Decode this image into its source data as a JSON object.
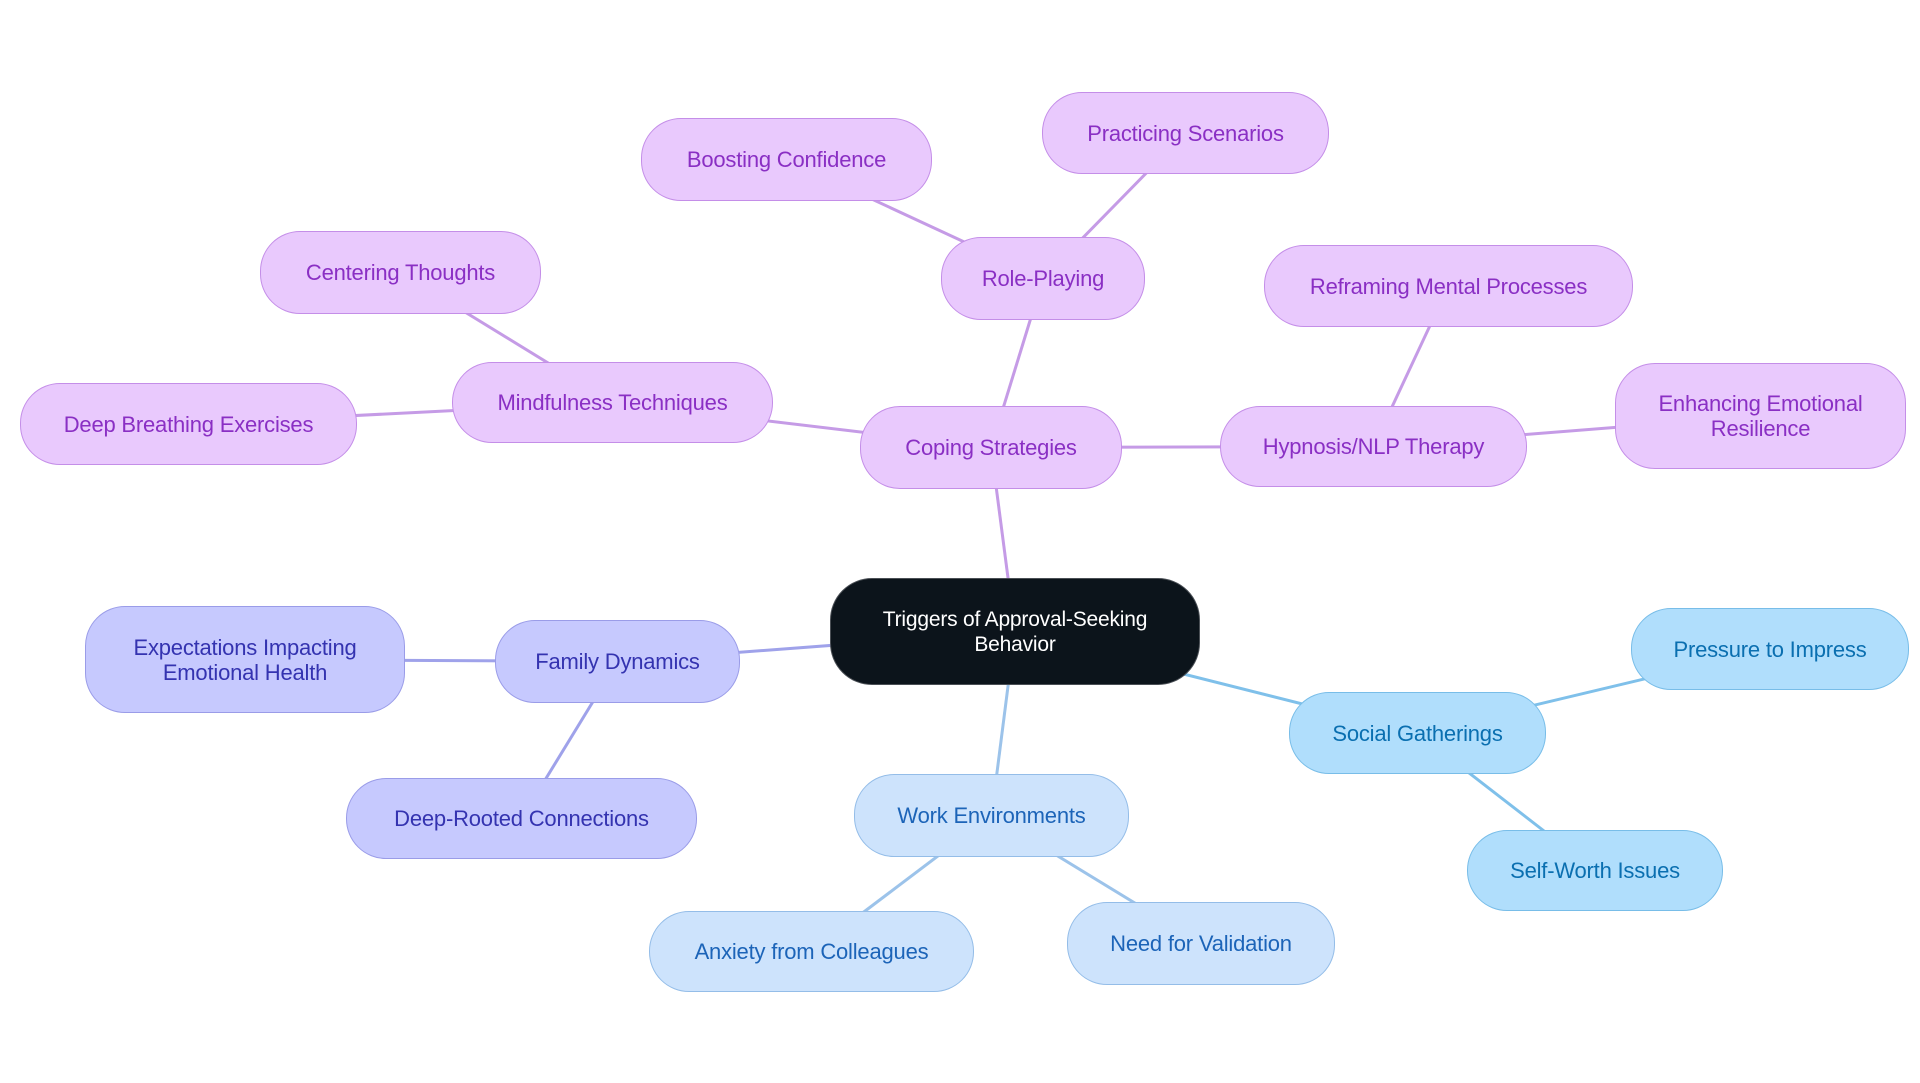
{
  "diagram": {
    "type": "mindmap",
    "colors": {
      "root": "#0c141b",
      "purple": "#e9c9fd",
      "purple_text": "#8a2fc4",
      "purple_edge": "#c59be6",
      "indigo": "#c6c9fe",
      "indigo_text": "#3433b0",
      "indigo_edge": "#9fa2ea",
      "lightblue": "#cde3fc",
      "lightblue_text": "#1c64b8",
      "lightblue_edge": "#9cc3ea",
      "skyblue": "#b0defc",
      "skyblue_text": "#0a6fb0",
      "skyblue_edge": "#7fc0ea"
    },
    "root": {
      "id": "root",
      "label": "Triggers of Approval-Seeking Behavior"
    },
    "nodes": [
      {
        "id": "coping",
        "label": "Coping Strategies",
        "parent": "root",
        "theme": "purple"
      },
      {
        "id": "mindfulness",
        "label": "Mindfulness Techniques",
        "parent": "coping",
        "theme": "purple"
      },
      {
        "id": "centering",
        "label": "Centering Thoughts",
        "parent": "mindfulness",
        "theme": "purple"
      },
      {
        "id": "breathing",
        "label": "Deep Breathing Exercises",
        "parent": "mindfulness",
        "theme": "purple"
      },
      {
        "id": "roleplaying",
        "label": "Role-Playing",
        "parent": "coping",
        "theme": "purple"
      },
      {
        "id": "boosting",
        "label": "Boosting Confidence",
        "parent": "roleplaying",
        "theme": "purple"
      },
      {
        "id": "practicing",
        "label": "Practicing Scenarios",
        "parent": "roleplaying",
        "theme": "purple"
      },
      {
        "id": "hypnosis",
        "label": "Hypnosis/NLP Therapy",
        "parent": "coping",
        "theme": "purple"
      },
      {
        "id": "reframing",
        "label": "Reframing Mental Processes",
        "parent": "hypnosis",
        "theme": "purple"
      },
      {
        "id": "enhancing",
        "label": "Enhancing Emotional Resilience",
        "parent": "hypnosis",
        "theme": "purple"
      },
      {
        "id": "family",
        "label": "Family Dynamics",
        "parent": "root",
        "theme": "indigo"
      },
      {
        "id": "expectations",
        "label": "Expectations Impacting Emotional Health",
        "parent": "family",
        "theme": "indigo"
      },
      {
        "id": "deeprooted",
        "label": "Deep-Rooted Connections",
        "parent": "family",
        "theme": "indigo"
      },
      {
        "id": "work",
        "label": "Work Environments",
        "parent": "root",
        "theme": "lightblue"
      },
      {
        "id": "anxiety",
        "label": "Anxiety from Colleagues",
        "parent": "work",
        "theme": "lightblue"
      },
      {
        "id": "validation",
        "label": "Need for Validation",
        "parent": "work",
        "theme": "lightblue"
      },
      {
        "id": "social",
        "label": "Social Gatherings",
        "parent": "root",
        "theme": "skyblue"
      },
      {
        "id": "pressure",
        "label": "Pressure to Impress",
        "parent": "social",
        "theme": "skyblue"
      },
      {
        "id": "selfworth",
        "label": "Self-Worth Issues",
        "parent": "social",
        "theme": "skyblue"
      }
    ]
  }
}
